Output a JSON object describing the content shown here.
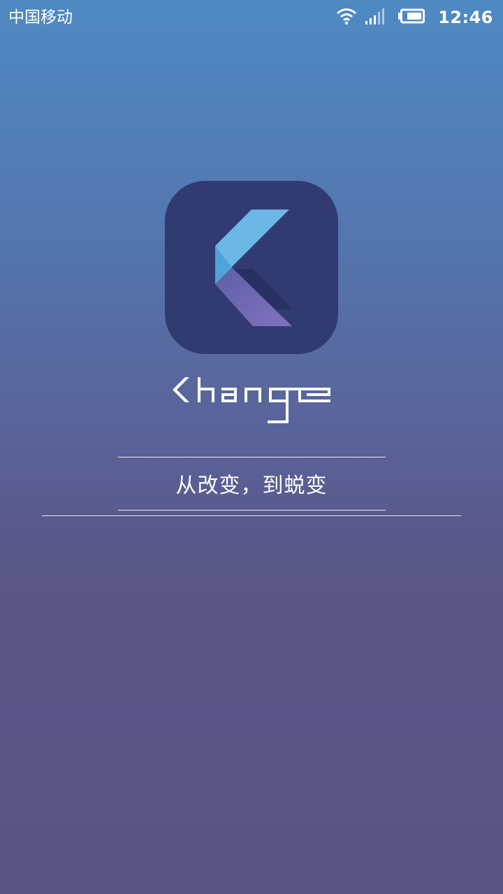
{
  "status_bar": {
    "carrier": "中国移动",
    "time": "12:46",
    "icons": [
      "wifi-icon",
      "signal-icon",
      "battery-icon"
    ]
  },
  "splash": {
    "logo_icon": "k-logo-icon",
    "logo_colors": {
      "tile": "#323a72",
      "upper_arm": "#6bb8e6",
      "lower_arm": "#7a6db5"
    },
    "wordmark": "Khange",
    "slogan": "从改变，到蜕变"
  }
}
